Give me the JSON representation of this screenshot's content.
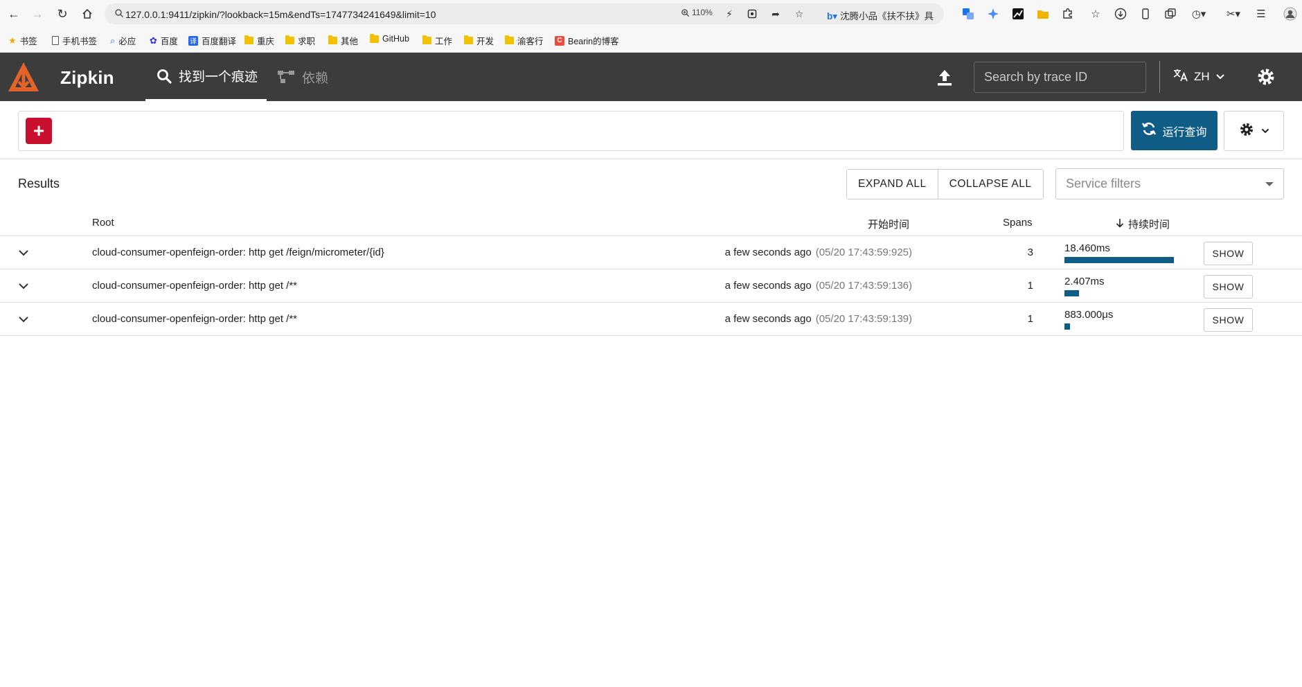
{
  "browser": {
    "url": "127.0.0.1:9411/zipkin/?lookback=15m&endTs=1747734241649&limit=10",
    "zoom": "110%",
    "bing_search": "沈腾小品《扶不扶》",
    "bing_search_tail": "具"
  },
  "bookmarks": [
    {
      "label": "书签",
      "icon": "star-icon"
    },
    {
      "label": "手机书签",
      "icon": "page-icon"
    },
    {
      "label": "必应",
      "icon": "search-icon"
    },
    {
      "label": "百度",
      "icon": "baidu-icon"
    },
    {
      "label": "百度翻译",
      "icon": "fanyi-icon"
    },
    {
      "label": "重庆",
      "icon": "folder-icon"
    },
    {
      "label": "求职",
      "icon": "folder-icon"
    },
    {
      "label": "其他",
      "icon": "folder-icon"
    },
    {
      "label": "GitHub",
      "icon": "folder-icon"
    },
    {
      "label": "工作",
      "icon": "folder-icon"
    },
    {
      "label": "开发",
      "icon": "folder-icon"
    },
    {
      "label": "渝客行",
      "icon": "folder-icon"
    },
    {
      "label": "Bearin的博客",
      "icon": "c-icon"
    }
  ],
  "header": {
    "title": "Zipkin",
    "tab_find": "找到一个痕迹",
    "tab_deps": "依赖",
    "search_placeholder": "Search by trace ID",
    "lang": "ZH"
  },
  "search": {
    "run_query": "运行查询"
  },
  "results": {
    "title": "Results",
    "expand_all": "EXPAND ALL",
    "collapse_all": "COLLAPSE ALL",
    "service_filters": "Service filters",
    "columns": {
      "root": "Root",
      "start_time": "开始时间",
      "spans": "Spans",
      "duration": "持续时间"
    },
    "rows": [
      {
        "root": "cloud-consumer-openfeign-order: http get /feign/micrometer/{id}",
        "relative": "a few seconds ago",
        "absolute": "(05/20 17:43:59:925)",
        "spans": "3",
        "duration": "18.460ms",
        "duration_fraction": 1.0,
        "show": "SHOW"
      },
      {
        "root": "cloud-consumer-openfeign-order: http get /**",
        "relative": "a few seconds ago",
        "absolute": "(05/20 17:43:59:136)",
        "spans": "1",
        "duration": "2.407ms",
        "duration_fraction": 0.13,
        "show": "SHOW"
      },
      {
        "root": "cloud-consumer-openfeign-order: http get /**",
        "relative": "a few seconds ago",
        "absolute": "(05/20 17:43:59:139)",
        "spans": "1",
        "duration": "883.000μs",
        "duration_fraction": 0.048,
        "show": "SHOW"
      }
    ]
  },
  "colors": {
    "header_bg": "#3c3c3c",
    "accent": "#0f5c87",
    "add_button": "#c8102e",
    "logo": "#e4632b"
  }
}
